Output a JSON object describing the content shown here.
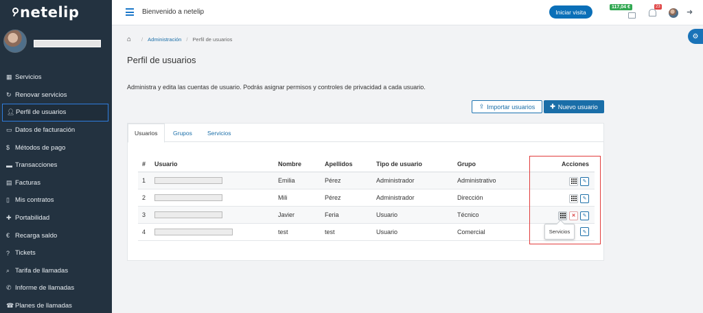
{
  "app": {
    "logo": "netelip"
  },
  "sidebar": {
    "items": [
      {
        "label": "Servicios",
        "icon": "grid-icon"
      },
      {
        "label": "Renovar servicios",
        "icon": "refresh-icon"
      },
      {
        "label": "Perfil de usuarios",
        "icon": "user-icon",
        "active": true
      },
      {
        "label": "Datos de facturación",
        "icon": "card-icon"
      },
      {
        "label": "Métodos de pago",
        "icon": "dollar-icon"
      },
      {
        "label": "Transacciones",
        "icon": "list-icon"
      },
      {
        "label": "Facturas",
        "icon": "invoice-icon"
      },
      {
        "label": "Mis contratos",
        "icon": "document-icon"
      },
      {
        "label": "Portabilidad",
        "icon": "plus-icon"
      },
      {
        "label": "Recarga saldo",
        "icon": "euro-icon"
      },
      {
        "label": "Tickets",
        "icon": "question-icon"
      },
      {
        "label": "Tarifa de llamadas",
        "icon": "search-icon"
      },
      {
        "label": "Informe de llamadas",
        "icon": "phone-icon"
      },
      {
        "label": "Planes de llamadas",
        "icon": "phone-desk-icon"
      }
    ]
  },
  "topbar": {
    "welcome": "Bienvenido a netelip",
    "visit_button": "Iniciar visita",
    "balance": "117,04 €",
    "notifications": "23"
  },
  "breadcrumb": {
    "items": [
      "Administración",
      "Perfil de usuarios"
    ]
  },
  "page": {
    "title": "Perfil de usuarios",
    "description": "Administra y edita las cuentas de usuario. Podrás asignar permisos y controles de privacidad a cada usuario.",
    "import_button": "Importar usuarios",
    "new_button": "Nuevo usuario"
  },
  "tabs": [
    "Usuarios",
    "Grupos",
    "Servicios"
  ],
  "table": {
    "headers": [
      "#",
      "Usuario",
      "Nombre",
      "Apellidos",
      "Tipo de usuario",
      "Grupo",
      "Acciones"
    ],
    "rows": [
      {
        "num": "1",
        "nombre": "Emilia",
        "apellidos": "Pérez",
        "tipo": "Administrador",
        "grupo": "Administrativo"
      },
      {
        "num": "2",
        "nombre": "Mili",
        "apellidos": "Pérez",
        "tipo": "Administrador",
        "grupo": "Dirección"
      },
      {
        "num": "3",
        "nombre": "Javier",
        "apellidos": "Feria",
        "tipo": "Usuario",
        "grupo": "Técnico"
      },
      {
        "num": "4",
        "nombre": "test",
        "apellidos": "test",
        "tipo": "Usuario",
        "grupo": "Comercial"
      }
    ]
  },
  "tooltip": "Servicios",
  "colors": {
    "sidebar": "#233240",
    "accent": "#1a6ea8",
    "highlight": "#e03a3a",
    "balance": "#32a852"
  }
}
